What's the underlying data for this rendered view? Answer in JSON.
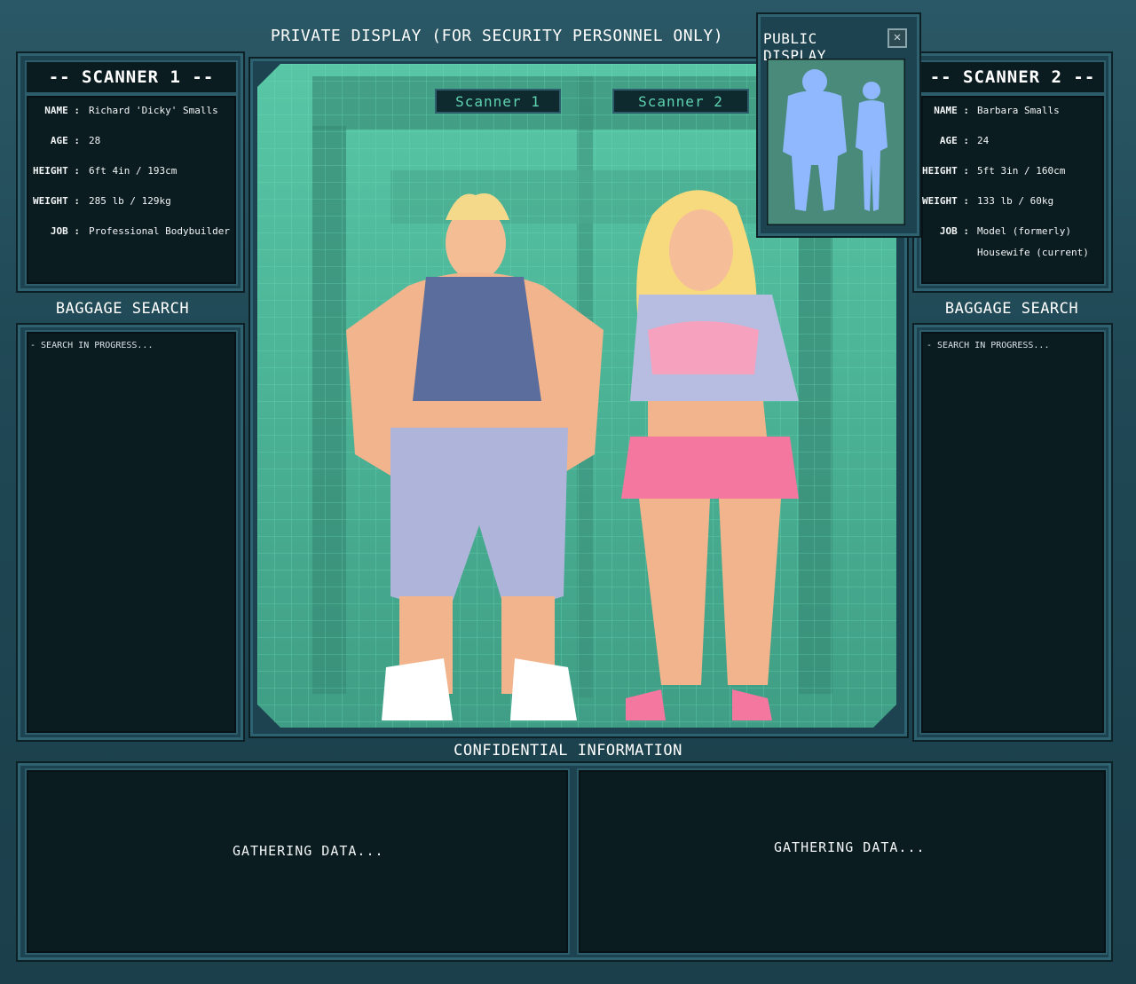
{
  "header": {
    "title": "PRIVATE DISPLAY (FOR SECURITY PERSONNEL ONLY)"
  },
  "public_display": {
    "title": "PUBLIC DISPLAY",
    "close_icon": "close-icon"
  },
  "scanner_tags": [
    "Scanner 1",
    "Scanner 2"
  ],
  "scanner1": {
    "title": "-- SCANNER 1 --",
    "fields": [
      {
        "label": "NAME :",
        "value": "Richard 'Dicky' Smalls"
      },
      {
        "label": "AGE :",
        "value": "28"
      },
      {
        "label": "HEIGHT :",
        "value": "6ft 4in / 193cm"
      },
      {
        "label": "WEIGHT :",
        "value": "285 lb / 129kg"
      },
      {
        "label": "JOB :",
        "value": "Professional Bodybuilder"
      }
    ],
    "baggage_title": "BAGGAGE SEARCH",
    "baggage_status": "- SEARCH IN PROGRESS..."
  },
  "scanner2": {
    "title": "-- SCANNER 2 --",
    "fields": [
      {
        "label": "NAME :",
        "value": "Barbara Smalls"
      },
      {
        "label": "AGE :",
        "value": "24"
      },
      {
        "label": "HEIGHT :",
        "value": "5ft 3in / 160cm"
      },
      {
        "label": "WEIGHT :",
        "value": "133 lb / 60kg"
      },
      {
        "label": "JOB :",
        "value": "Model (formerly)"
      }
    ],
    "job_extra": "Housewife (current)",
    "baggage_title": "BAGGAGE SEARCH",
    "baggage_status": "- SEARCH IN PROGRESS..."
  },
  "confidential": {
    "title": "CONFIDENTIAL INFORMATION",
    "left_status": "GATHERING DATA...",
    "right_status": "GATHERING DATA..."
  },
  "colors": {
    "frame": "#1f4754",
    "screen": "#0b1c21",
    "grid": "#5fd3b0",
    "silhouette": "#8fb8ff"
  }
}
